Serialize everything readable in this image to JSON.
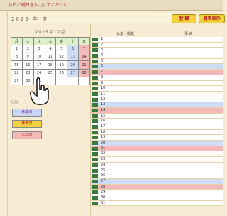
{
  "titlebar": "休日に曜日を入力してください",
  "year": {
    "value": "2025",
    "label": "年 度"
  },
  "buttons": {
    "register": "登 録",
    "display": "週表表示"
  },
  "calendar": {
    "month_label": "2025年12月",
    "weekdays": [
      "月",
      "火",
      "水",
      "木",
      "金",
      "土",
      "日"
    ],
    "weeks": [
      [
        "1",
        "2",
        "3",
        "4",
        "5",
        "6",
        "7"
      ],
      [
        "8",
        "9",
        "10",
        "11",
        "12",
        "13",
        "14"
      ],
      [
        "15",
        "16",
        "17",
        "18",
        "19",
        "20",
        "21"
      ],
      [
        "22",
        "23",
        "24",
        "25",
        "26",
        "27",
        "28"
      ],
      [
        "29",
        "30",
        "31",
        "",
        "",
        "",
        ""
      ]
    ]
  },
  "legend": {
    "title": "凡例",
    "items": [
      "休業日",
      "休業日",
      "公休日"
    ]
  },
  "schedule": {
    "headers": [
      "休業・開業",
      "事 由"
    ],
    "days": [
      "1",
      "2",
      "3",
      "4",
      "5",
      "6",
      "7",
      "8",
      "9",
      "10",
      "11",
      "12",
      "13",
      "14",
      "15",
      "16",
      "17",
      "18",
      "19",
      "20",
      "21",
      "22",
      "23",
      "24",
      "25",
      "26",
      "27",
      "28",
      "29",
      "30",
      "31"
    ]
  },
  "colors": {
    "holiday": "#f4b8b8",
    "saturday": "#cfdcf5",
    "accent": "#f5d040"
  }
}
